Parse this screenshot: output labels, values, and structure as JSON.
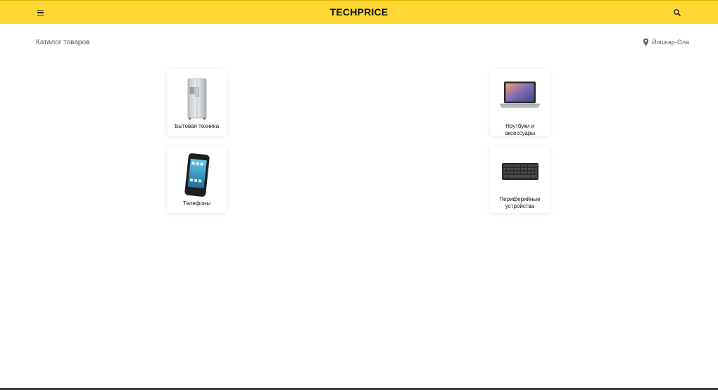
{
  "header": {
    "brand": "TECHPRICE",
    "accent_color": "#fdd835",
    "menu_icon": "hamburger-icon",
    "search_icon": "search-icon"
  },
  "subheader": {
    "breadcrumb": "Каталог товаров",
    "city": "Йошкар-Ола",
    "city_icon": "location-pin-icon"
  },
  "catalog": {
    "categories": [
      {
        "label": "Бытовая техника",
        "icon": "refrigerator-image"
      },
      {
        "label": "Ноутбуки и аксессуары",
        "icon": "laptop-image"
      },
      {
        "label": "Телефоны",
        "icon": "smartphone-image"
      },
      {
        "label": "Периферийные устройства",
        "icon": "keyboard-image"
      }
    ]
  }
}
